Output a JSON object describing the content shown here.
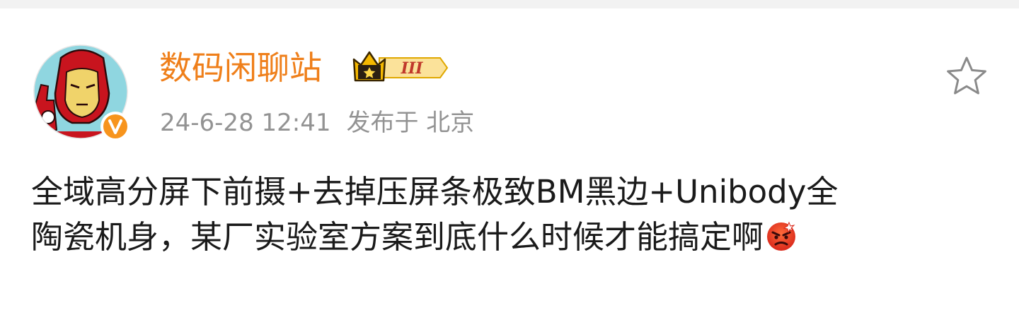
{
  "post": {
    "author": {
      "name": "数码闲聊站",
      "level_badge": "III",
      "avatar_icon": "iron-man-avatar-icon",
      "verified_icon": "verified-v-badge-icon"
    },
    "meta": {
      "timestamp": "24-6-28 12:41",
      "location": "发布于 北京"
    },
    "favorite_icon": "star-outline-icon",
    "content": {
      "line1": "全域高分屏下前摄+去掉压屏条极致BM黑边+Unibody全",
      "line2": "陶瓷机身，某厂实验室方案到底什么时候才能搞定啊",
      "emoji": "angry-face-emoji"
    }
  },
  "colors": {
    "username": "#ef7f1a",
    "meta_text": "#939393",
    "body_text": "#1a1a1a",
    "verified_badge": "#f7941d",
    "crown_gold": "#f5b800"
  }
}
